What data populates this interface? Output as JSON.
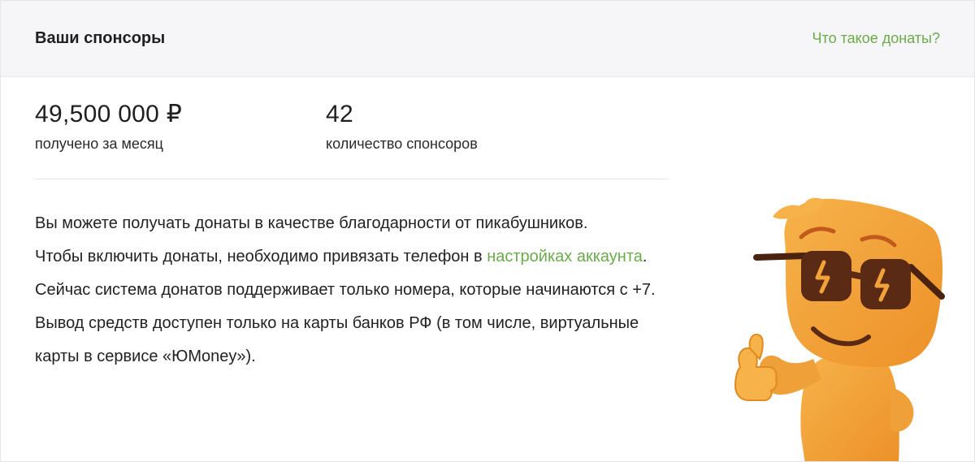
{
  "header": {
    "title": "Ваши спонсоры",
    "help_link": "Что такое донаты?"
  },
  "stats": [
    {
      "value": "49,500 000 ₽",
      "label": "получено за месяц"
    },
    {
      "value": "42",
      "label": "количество спонсоров"
    }
  ],
  "info": {
    "paragraph1": "Вы можете получать донаты в качестве благодарности от пикабушников.",
    "paragraph2_before_link": "Чтобы включить донаты, необходимо привязать телефон в ",
    "paragraph2_link": "настройках аккаунта",
    "paragraph2_after_link": ". Сейчас система донатов поддерживает только номера, которые начинаются с +7.",
    "paragraph3": "Вывод средств доступен только на карты банков РФ (в том числе, виртуальные карты в сервисе «ЮMoney»)."
  },
  "mascot": {
    "icon": "mascot-with-sunglasses-thumbs-up",
    "body_color": "#f3a23a",
    "glasses_color": "#5a2a14",
    "lightning_color": "#f3a23a"
  },
  "colors": {
    "accent": "#6aab4b",
    "header_bg": "#f6f6f8"
  }
}
